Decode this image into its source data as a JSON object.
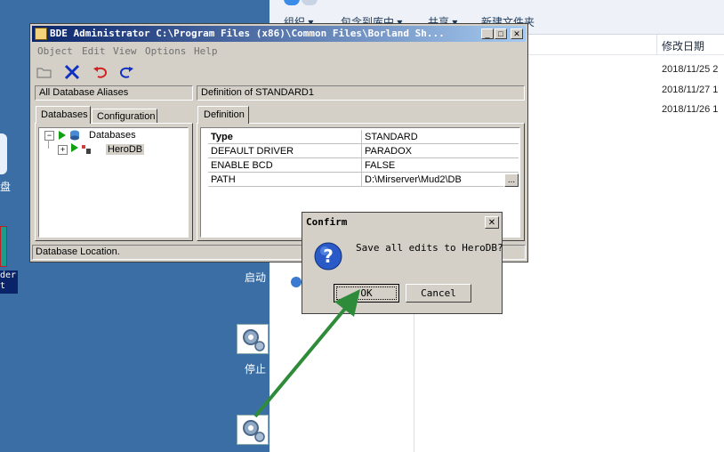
{
  "bde": {
    "title": "BDE Administrator  C:\\Program Files (x86)\\Common Files\\Borland Sh...",
    "menu": [
      "Object",
      "Edit",
      "View",
      "Options",
      "Help"
    ],
    "left_header": "All Database Aliases",
    "right_header": "Definition of STANDARD1",
    "tabs": [
      "Databases",
      "Configuration"
    ],
    "def_tab": "Definition",
    "tree": [
      {
        "label": "Databases",
        "expander": "−"
      },
      {
        "label": "HeroDB",
        "expander": "+"
      }
    ],
    "properties": [
      {
        "key": "Type",
        "value": "STANDARD"
      },
      {
        "key": "DEFAULT DRIVER",
        "value": "PARADOX"
      },
      {
        "key": "ENABLE BCD",
        "value": "FALSE"
      },
      {
        "key": "PATH",
        "value": "D:\\Mirserver\\Mud2\\DB"
      }
    ],
    "ellipsis": "...",
    "status": "Database Location."
  },
  "dialog": {
    "title": "Confirm",
    "message": "Save all edits to HeroDB?",
    "ok": "OK",
    "cancel": "Cancel",
    "close": "✕",
    "icon": "question-icon"
  },
  "explorer": {
    "toolbar": [
      "组织 ▾",
      "包含到库中 ▾",
      "共享 ▾",
      "新建文件夹"
    ],
    "column_header": "修改日期",
    "dates": [
      "2018/11/25 2",
      "2018/11/27 1",
      "2018/11/26 1"
    ]
  },
  "desktop": {
    "start_label": "启动",
    "stop_label": "停止",
    "left_partial_1": "盘",
    "left_partial_2": "der",
    "left_partial_3": "t"
  },
  "colors": {
    "titlebar": "#0a246a",
    "desktop": "#3a6ea5",
    "arrow": "#2e8b3a"
  }
}
